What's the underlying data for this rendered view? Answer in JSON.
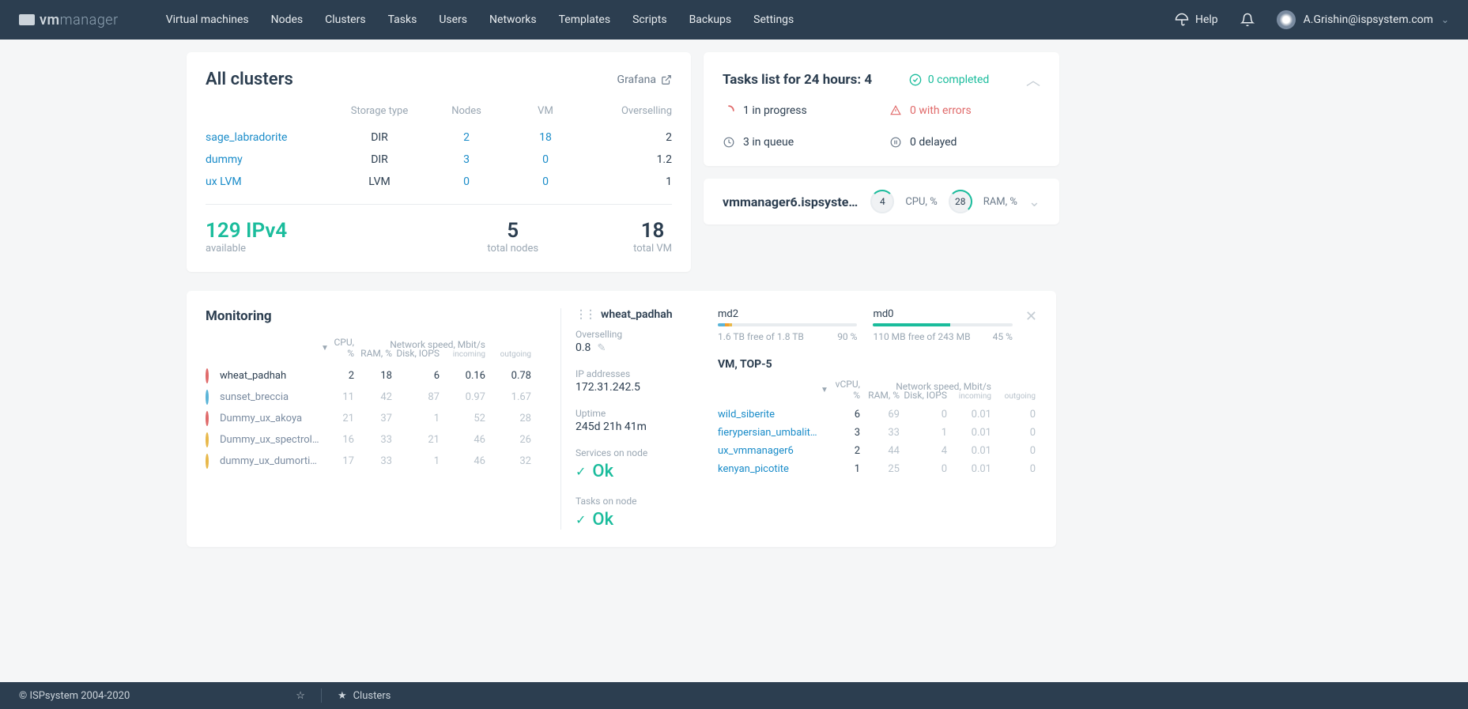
{
  "app": {
    "name": "vmmanager",
    "prefix": "vm",
    "suffix": "manager"
  },
  "nav": [
    "Virtual machines",
    "Nodes",
    "Clusters",
    "Tasks",
    "Users",
    "Networks",
    "Templates",
    "Scripts",
    "Backups",
    "Settings"
  ],
  "help": "Help",
  "user": {
    "email": "A.Grishin@ispsystem.com"
  },
  "allClusters": {
    "title": "All clusters",
    "grafana": "Grafana",
    "headers": [
      "Storage type",
      "Nodes",
      "VM",
      "Overselling"
    ],
    "rows": [
      {
        "name": "sage_labradorite",
        "storage": "DIR",
        "nodes": "2",
        "vm": "18",
        "over": "2"
      },
      {
        "name": "dummy",
        "storage": "DIR",
        "nodes": "3",
        "vm": "0",
        "over": "1.2"
      },
      {
        "name": "ux LVM",
        "storage": "LVM",
        "nodes": "0",
        "vm": "0",
        "over": "1"
      }
    ],
    "ipv4": {
      "count": "129 IPv4",
      "label": "available"
    },
    "totalNodes": {
      "count": "5",
      "label": "total nodes"
    },
    "totalVM": {
      "count": "18",
      "label": "total VM"
    }
  },
  "tasks": {
    "title": "Tasks list for 24 hours: 4",
    "completed": "0 completed",
    "progress": "1 in progress",
    "errors": "0 with errors",
    "queue": "3 in queue",
    "delayed": "0 delayed"
  },
  "nodeSummary": {
    "name": "vmmanager6.ispsystem...",
    "cpu": {
      "val": "4",
      "label": "CPU, %"
    },
    "ram": {
      "val": "28",
      "label": "RAM, %"
    }
  },
  "monitoring": {
    "title": "Monitoring",
    "headers": {
      "cpu": "CPU, %",
      "ram": "RAM, %",
      "disk": "Disk, IOPS",
      "net": "Network speed, Mbit/s",
      "incoming": "incoming",
      "outgoing": "outgoing"
    },
    "rows": [
      {
        "name": "wheat_padhah",
        "dot": "red",
        "cpu": "2",
        "ram": "18",
        "disk": "6",
        "in": "0.16",
        "out": "0.78",
        "active": true
      },
      {
        "name": "sunset_breccia",
        "dot": "blue",
        "cpu": "11",
        "ram": "42",
        "disk": "87",
        "in": "0.97",
        "out": "1.67"
      },
      {
        "name": "Dummy_ux_akoya",
        "dot": "red",
        "cpu": "21",
        "ram": "37",
        "disk": "1",
        "in": "52",
        "out": "28"
      },
      {
        "name": "Dummy_ux_spectrolite",
        "dot": "yellow",
        "cpu": "16",
        "ram": "33",
        "disk": "21",
        "in": "46",
        "out": "26"
      },
      {
        "name": "dummy_ux_dumortier...",
        "dot": "yellow",
        "cpu": "17",
        "ram": "33",
        "disk": "1",
        "in": "46",
        "out": "32"
      }
    ]
  },
  "nodeDetail": {
    "name": "wheat_padhah",
    "overselling": {
      "label": "Overselling",
      "val": "0.8"
    },
    "ip": {
      "label": "IP addresses",
      "val": "172.31.242.5"
    },
    "uptime": {
      "label": "Uptime",
      "val": "245d 21h 41m"
    },
    "services": {
      "label": "Services on node",
      "status": "Ok"
    },
    "tasksOnNode": {
      "label": "Tasks on node",
      "status": "Ok"
    },
    "disks": [
      {
        "name": "md2",
        "info": "1.6 TB free of 1.8 TB",
        "pct": "90 %"
      },
      {
        "name": "md0",
        "info": "110 MB free of 243 MB",
        "pct": "45 %"
      }
    ],
    "vmTop": {
      "title": "VM, TOP-5",
      "headers": {
        "vcpu": "vCPU, %",
        "ram": "RAM, %",
        "disk": "Disk, IOPS",
        "net": "Network speed, Mbit/s",
        "incoming": "incoming",
        "outgoing": "outgoing"
      },
      "rows": [
        {
          "name": "wild_siberite",
          "vcpu": "6",
          "ram": "69",
          "disk": "0",
          "in": "0.01",
          "out": "0"
        },
        {
          "name": "fierypersian_umbalite_ux",
          "vcpu": "3",
          "ram": "33",
          "disk": "1",
          "in": "0.01",
          "out": "0"
        },
        {
          "name": "ux_vmmanager6",
          "vcpu": "2",
          "ram": "44",
          "disk": "4",
          "in": "0.01",
          "out": "0"
        },
        {
          "name": "kenyan_picotite",
          "vcpu": "1",
          "ram": "25",
          "disk": "0",
          "in": "0.01",
          "out": "0"
        }
      ]
    }
  },
  "footer": {
    "copyright": "© ISPsystem 2004-2020",
    "crumb": "Clusters"
  }
}
